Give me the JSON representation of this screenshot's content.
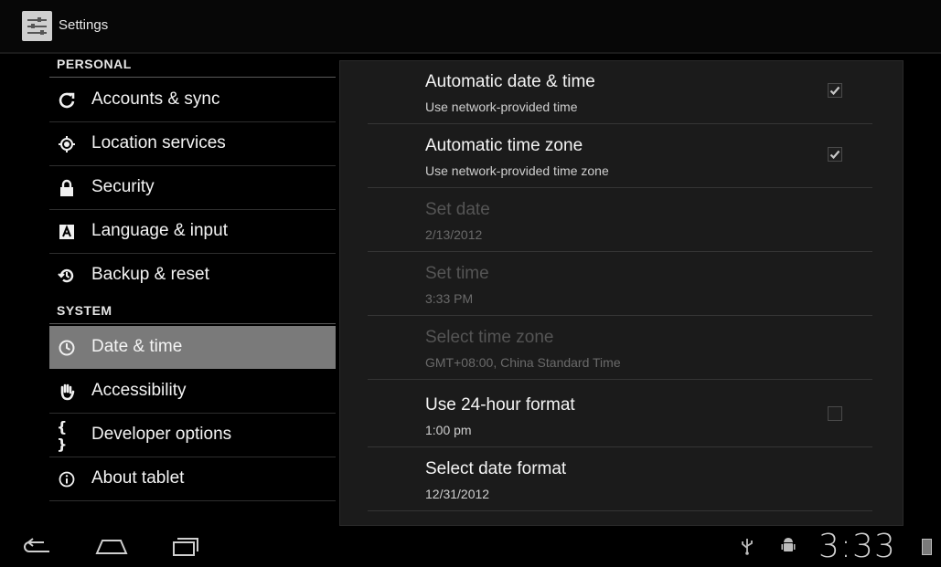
{
  "app": {
    "title": "Settings",
    "icon": "settings-sliders-icon"
  },
  "sidebar": {
    "sections": [
      {
        "header": "PERSONAL"
      },
      {
        "header": "SYSTEM"
      }
    ],
    "items": [
      {
        "label": "Accounts & sync",
        "icon": "sync-icon",
        "glyph": "↻"
      },
      {
        "label": "Location services",
        "icon": "location-icon",
        "glyph": "◉"
      },
      {
        "label": "Security",
        "icon": "lock-icon",
        "glyph": "🔒"
      },
      {
        "label": "Language & input",
        "icon": "language-icon",
        "glyph": "A"
      },
      {
        "label": "Backup & reset",
        "icon": "backup-icon",
        "glyph": "⟲"
      },
      {
        "label": "Date & time",
        "icon": "clock-icon",
        "glyph": "◷",
        "selected": true
      },
      {
        "label": "Accessibility",
        "icon": "hand-icon",
        "glyph": "✋"
      },
      {
        "label": "Developer options",
        "icon": "braces-icon",
        "glyph": "{ }"
      },
      {
        "label": "About tablet",
        "icon": "info-icon",
        "glyph": "ⓘ"
      }
    ]
  },
  "prefs": [
    {
      "title": "Automatic date & time",
      "summary": "Use network-provided time",
      "checkbox": true,
      "checked": true,
      "disabled": false
    },
    {
      "title": "Automatic time zone",
      "summary": "Use network-provided time zone",
      "checkbox": true,
      "checked": true,
      "disabled": false
    },
    {
      "title": "Set date",
      "summary": "2/13/2012",
      "checkbox": false,
      "disabled": true
    },
    {
      "title": "Set time",
      "summary": "3:33 PM",
      "checkbox": false,
      "disabled": true
    },
    {
      "title": "Select time zone",
      "summary": "GMT+08:00, China Standard Time",
      "checkbox": false,
      "disabled": true
    },
    {
      "title": "Use 24-hour format",
      "summary": "1:00 pm",
      "checkbox": true,
      "checked": false,
      "disabled": false
    },
    {
      "title": "Select date format",
      "summary": "12/31/2012",
      "checkbox": false,
      "disabled": false
    }
  ],
  "status": {
    "time": "3:33",
    "icons": [
      "usb-icon",
      "android-debug-icon",
      "battery-icon"
    ]
  },
  "navbar": {
    "buttons": [
      "back-icon",
      "home-icon",
      "recent-apps-icon"
    ]
  },
  "colors": {
    "selected_bg": "#7a7a7a",
    "panel_bg": "#1b1b1b",
    "disabled_text": "#555555"
  }
}
